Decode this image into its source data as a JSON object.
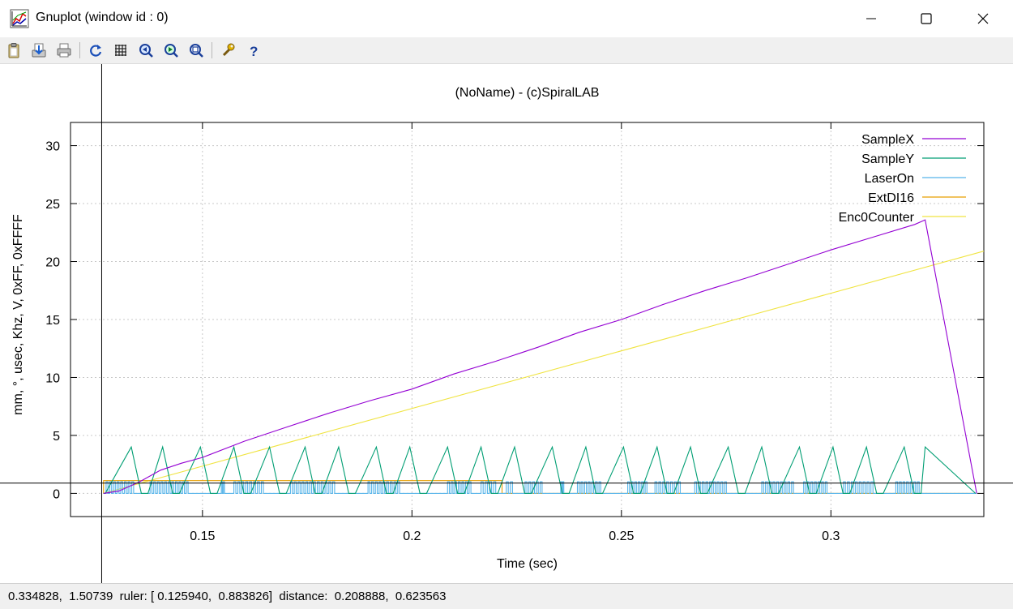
{
  "window": {
    "title": "Gnuplot (window id : 0)"
  },
  "toolbar": {
    "buttons": [
      {
        "name": "copy-clipboard-button",
        "icon": "clipboard-icon"
      },
      {
        "name": "export-button",
        "icon": "export-icon"
      },
      {
        "name": "print-button",
        "icon": "printer-icon"
      },
      {
        "name": "replot-button",
        "icon": "refresh-icon"
      },
      {
        "name": "grid-button",
        "icon": "grid-icon"
      },
      {
        "name": "zoom-previous-button",
        "icon": "zoom-previous-icon"
      },
      {
        "name": "zoom-next-button",
        "icon": "zoom-next-icon"
      },
      {
        "name": "unzoom-button",
        "icon": "unzoom-icon"
      },
      {
        "name": "options-button",
        "icon": "wrench-icon"
      },
      {
        "name": "help-button",
        "icon": "help-icon"
      }
    ]
  },
  "status": {
    "text": "0.334828,  1.50739  ruler: [ 0.125940,  0.883826]  distance:  0.208888,  0.623563"
  },
  "chart_data": {
    "type": "line",
    "title": "(NoName) - (c)SpiralLAB",
    "xlabel": "Time (sec)",
    "ylabel": "mm, °, usec, Khz, V, 0xFF, 0xFFFF",
    "xlim": [
      0.1185,
      0.3365
    ],
    "ylim": [
      -2,
      32
    ],
    "xticks": [
      0.15,
      0.2,
      0.25,
      0.3
    ],
    "xtick_labels": [
      "0.15",
      "0.2",
      "0.25",
      "0.3"
    ],
    "yticks": [
      0,
      5,
      10,
      15,
      20,
      25,
      30
    ],
    "ytick_labels": [
      "0",
      "5",
      "10",
      "15",
      "20",
      "25",
      "30"
    ],
    "grid": true,
    "legend": "top-right",
    "ruler": [
      0.12594,
      0.883826
    ],
    "series": [
      {
        "name": "SampleX",
        "color": "#9400d3",
        "x": [
          0.1264,
          0.13,
          0.135,
          0.14,
          0.145,
          0.15,
          0.16,
          0.17,
          0.18,
          0.19,
          0.2,
          0.21,
          0.22,
          0.23,
          0.24,
          0.25,
          0.26,
          0.27,
          0.28,
          0.29,
          0.3,
          0.31,
          0.32,
          0.3225,
          0.3348
        ],
        "y": [
          0,
          0.2,
          1.0,
          2.0,
          2.6,
          3.1,
          4.5,
          5.7,
          6.9,
          8.0,
          9.0,
          10.3,
          11.4,
          12.6,
          13.9,
          15.0,
          16.3,
          17.5,
          18.6,
          19.8,
          21.0,
          22.1,
          23.2,
          23.6,
          0
        ]
      },
      {
        "name": "SampleY",
        "color": "#009e73",
        "peaks": [
          0.133,
          0.1405,
          0.1495,
          0.1575,
          0.166,
          0.1745,
          0.1825,
          0.1915,
          0.1995,
          0.2085,
          0.2165,
          0.2245,
          0.2335,
          0.2415,
          0.2505,
          0.2585,
          0.2665,
          0.2755,
          0.2835,
          0.2925,
          0.3005,
          0.3085,
          0.3175,
          0.3225
        ],
        "peak_value": 4,
        "base_value": 0,
        "end_x": 0.3345
      },
      {
        "name": "LaserOn",
        "color": "#56b4e9",
        "on_value": 1,
        "off_value": 0,
        "x_start": 0.1264,
        "x_end": 0.3348,
        "pulse_bursts": [
          [
            0.127,
            0.134
          ],
          [
            0.1375,
            0.147
          ],
          [
            0.1545,
            0.1555
          ],
          [
            0.1575,
            0.165
          ],
          [
            0.171,
            0.182
          ],
          [
            0.1895,
            0.1975
          ],
          [
            0.2085,
            0.2145
          ],
          [
            0.2165,
            0.2205
          ],
          [
            0.2225,
            0.2245
          ],
          [
            0.227,
            0.2315
          ],
          [
            0.2355,
            0.2365
          ],
          [
            0.2395,
            0.2455
          ],
          [
            0.2515,
            0.2565
          ],
          [
            0.258,
            0.2645
          ],
          [
            0.2675,
            0.2755
          ],
          [
            0.2835,
            0.2915
          ],
          [
            0.2935,
            0.2995
          ],
          [
            0.303,
            0.3105
          ],
          [
            0.3155,
            0.3215
          ]
        ]
      },
      {
        "name": "ExtDI16",
        "color": "#e69f00",
        "x": [
          0.1264,
          0.1264,
          0.2215,
          0.2215,
          0.3348
        ],
        "y": [
          0,
          1.1,
          1.1,
          0,
          0
        ]
      },
      {
        "name": "Enc0Counter",
        "color": "#f0e442",
        "x": [
          0.1264,
          0.3365
        ],
        "y": [
          0,
          20.9
        ]
      }
    ]
  }
}
